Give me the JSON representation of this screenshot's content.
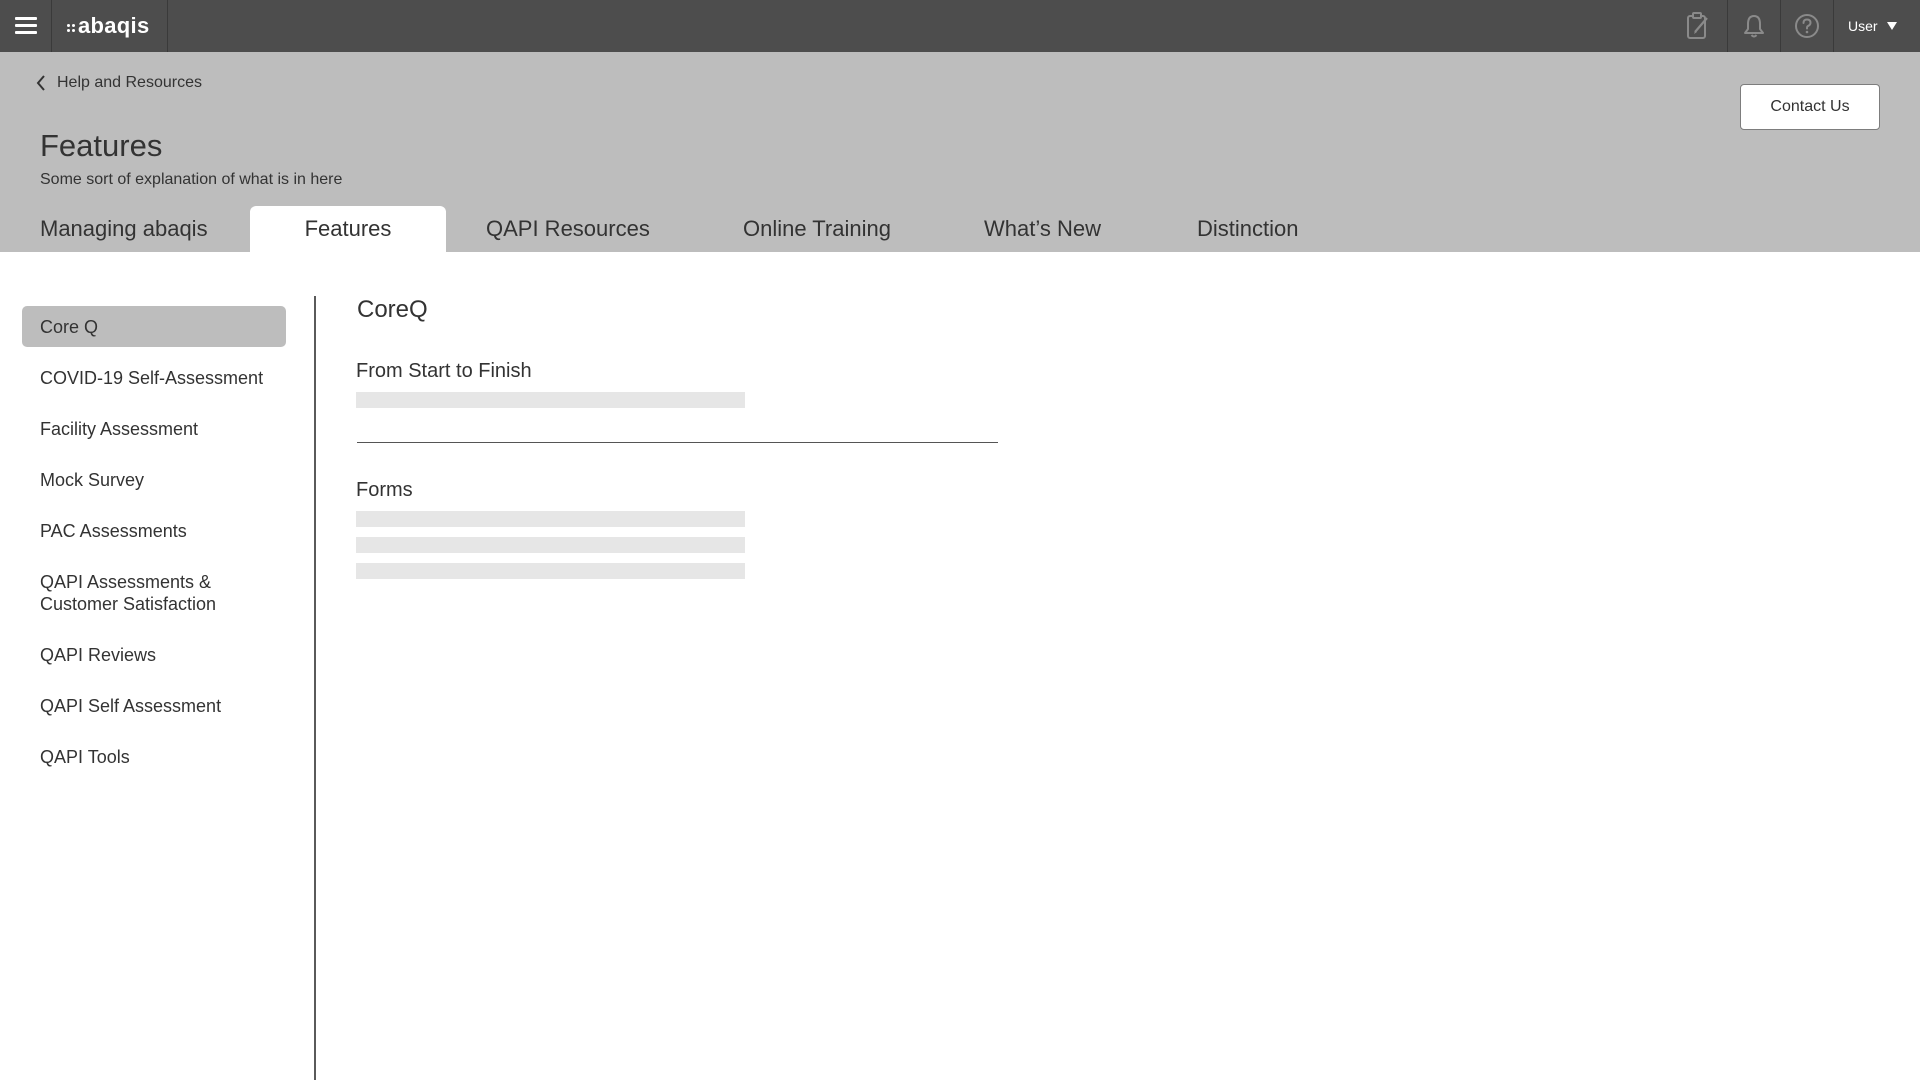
{
  "topbar": {
    "brand": "abaqis",
    "icons": [
      "menu-icon",
      "clipboard-icon",
      "bell-icon",
      "help-icon"
    ],
    "user_label": "User"
  },
  "header": {
    "back_label": "Help and Resources",
    "title": "Features",
    "subtitle": "Some sort of explanation of what is in here",
    "contact_label": "Contact Us"
  },
  "tabs": [
    {
      "label": "Managing abaqis",
      "active": false
    },
    {
      "label": "Features",
      "active": true
    },
    {
      "label": "QAPI Resources",
      "active": false
    },
    {
      "label": "Online Training",
      "active": false
    },
    {
      "label": "What’s New",
      "active": false
    },
    {
      "label": "Distinction",
      "active": false
    }
  ],
  "sidebar": {
    "items": [
      {
        "label": "Core Q",
        "active": true
      },
      {
        "label": "COVID-19 Self-Assessment",
        "active": false
      },
      {
        "label": "Facility Assessment",
        "active": false
      },
      {
        "label": "Mock Survey",
        "active": false
      },
      {
        "label": "PAC Assessments",
        "active": false
      },
      {
        "label": "QAPI Assessments & Customer Satisfaction",
        "active": false
      },
      {
        "label": "QAPI Reviews",
        "active": false
      },
      {
        "label": "QAPI Self Assessment",
        "active": false
      },
      {
        "label": "QAPI Tools",
        "active": false
      }
    ]
  },
  "content": {
    "title": "CoreQ",
    "sections": [
      {
        "heading": "From Start to Finish",
        "placeholder_lines": 1
      },
      {
        "heading": "Forms",
        "placeholder_lines": 3
      }
    ]
  },
  "colors": {
    "topbar": "#4d4d4d",
    "header": "#bdbdbd",
    "active_item": "#bdbdbd",
    "placeholder": "#e6e6e6"
  }
}
